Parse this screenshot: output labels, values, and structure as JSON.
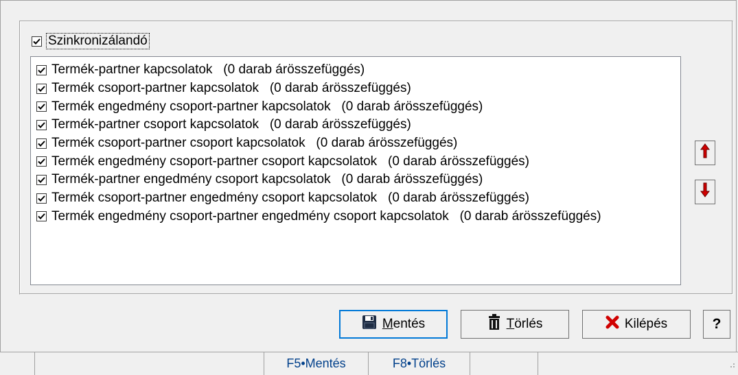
{
  "sync": {
    "label": "Szinkronizálandó",
    "checked": true
  },
  "list": {
    "items": [
      {
        "label": "Termék-partner kapcsolatok   (0 darab árösszefüggés)"
      },
      {
        "label": "Termék csoport-partner kapcsolatok   (0 darab árösszefüggés)"
      },
      {
        "label": "Termék engedmény csoport-partner kapcsolatok   (0 darab árösszefüggés)"
      },
      {
        "label": "Termék-partner csoport kapcsolatok   (0 darab árösszefüggés)"
      },
      {
        "label": "Termék csoport-partner csoport kapcsolatok   (0 darab árösszefüggés)"
      },
      {
        "label": "Termék engedmény csoport-partner csoport kapcsolatok   (0 darab árösszefüggés)"
      },
      {
        "label": "Termék-partner engedmény csoport kapcsolatok   (0 darab árösszefüggés)"
      },
      {
        "label": "Termék csoport-partner engedmény csoport kapcsolatok   (0 darab árösszefüggés)"
      },
      {
        "label": "Termék engedmény csoport-partner engedmény csoport kapcsolatok   (0 darab árösszefüggés)"
      }
    ]
  },
  "buttons": {
    "save": {
      "mnemonic": "M",
      "rest": "entés",
      "icon": "floppy-disk-icon"
    },
    "delete": {
      "mnemonic": "T",
      "rest": "örlés",
      "icon": "trash-icon"
    },
    "exit": {
      "label": "Kilépés",
      "icon": "red-x-icon"
    },
    "help": {
      "label": "?"
    },
    "move_up": {
      "icon": "red-arrow-up-icon"
    },
    "move_down": {
      "icon": "red-arrow-down-icon"
    }
  },
  "status_bar": {
    "cells": [
      "",
      "",
      "F5•Mentés",
      "F8•Törlés",
      ""
    ]
  },
  "colors": {
    "accent": "#0078d7",
    "arrow_red": "#d00000",
    "shortcut_blue": "#003f8a"
  }
}
